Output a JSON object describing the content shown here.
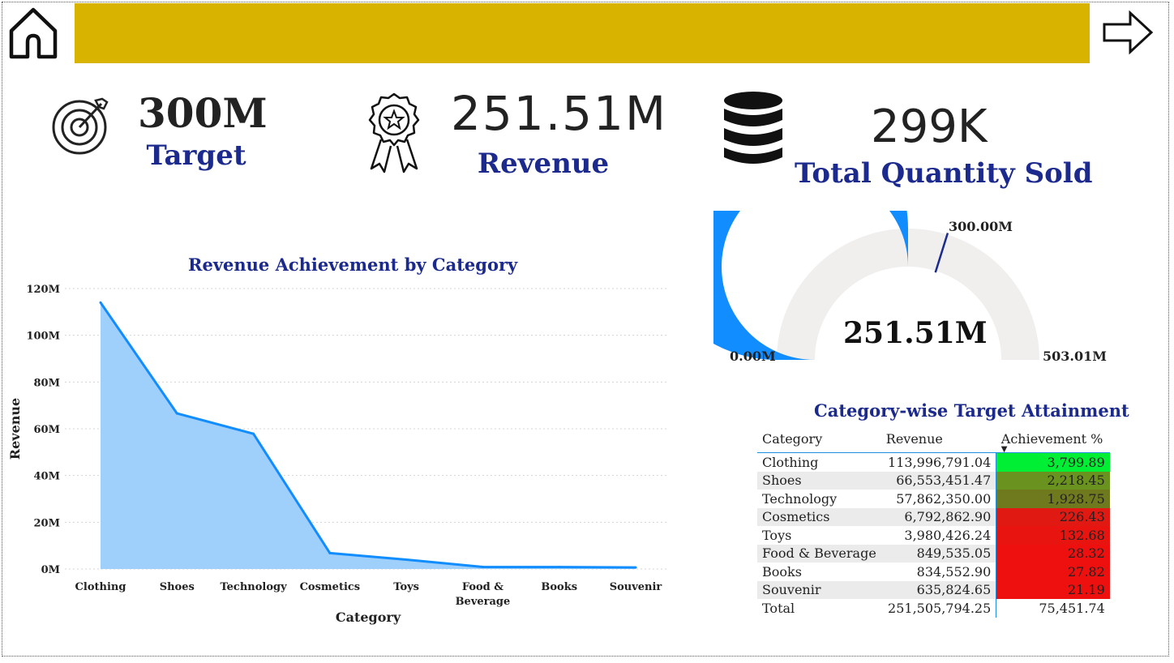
{
  "header": {
    "home_icon": "home-icon",
    "next_icon": "arrow-right-icon",
    "banner_color": "#d8b400"
  },
  "kpis": {
    "target": {
      "value": "300M",
      "label": "Target",
      "icon": "target-icon"
    },
    "revenue": {
      "value": "251.51M",
      "label": "Revenue",
      "icon": "award-ribbon-icon"
    },
    "quantity": {
      "value": "299K",
      "label": "Total Quantity Sold",
      "icon": "database-icon"
    }
  },
  "gauge": {
    "value": 251.51,
    "min": 0,
    "max": 503.01,
    "target": 300,
    "value_label": "251.51M",
    "min_label": "0.00M",
    "max_label": "503.01M",
    "target_label": "300.00M",
    "fill_color": "#118dff",
    "track_color": "#f0efee"
  },
  "chart_data": {
    "type": "area",
    "title": "Revenue Achievement by Category",
    "xlabel": "Category",
    "ylabel": "Revenue",
    "categories": [
      "Clothing",
      "Shoes",
      "Technology",
      "Cosmetics",
      "Toys",
      "Food & Beverage",
      "Books",
      "Souvenir"
    ],
    "values": [
      113996791.04,
      66553451.47,
      57862350.0,
      6792862.9,
      3980426.24,
      849535.05,
      834552.9,
      635824.65
    ],
    "yticks": [
      "0M",
      "20M",
      "40M",
      "60M",
      "80M",
      "100M",
      "120M"
    ],
    "ylim": [
      0,
      120000000
    ],
    "grid": true,
    "line_color": "#118dff",
    "fill_color": "#9fd0fb"
  },
  "table": {
    "title": "Category-wise Target Attainment",
    "columns": [
      "Category",
      "Revenue",
      "Achievement %"
    ],
    "rows": [
      {
        "category": "Clothing",
        "revenue": "113,996,791.04",
        "achievement": "3,799.89",
        "color": "#00ee33"
      },
      {
        "category": "Shoes",
        "revenue": "66,553,451.47",
        "achievement": "2,218.45",
        "color": "#6a921e"
      },
      {
        "category": "Technology",
        "revenue": "57,862,350.00",
        "achievement": "1,928.75",
        "color": "#6f7a1e"
      },
      {
        "category": "Cosmetics",
        "revenue": "6,792,862.90",
        "achievement": "226.43",
        "color": "#e01a12"
      },
      {
        "category": "Toys",
        "revenue": "3,980,426.24",
        "achievement": "132.68",
        "color": "#e8140f"
      },
      {
        "category": "Food & Beverage",
        "revenue": "849,535.05",
        "achievement": "28.32",
        "color": "#ee0f0f"
      },
      {
        "category": "Books",
        "revenue": "834,552.90",
        "achievement": "27.82",
        "color": "#ee0f0f"
      },
      {
        "category": "Souvenir",
        "revenue": "635,824.65",
        "achievement": "21.19",
        "color": "#ee0f0f"
      }
    ],
    "total": {
      "category": "Total",
      "revenue": "251,505,794.25",
      "achievement": "75,451.74"
    }
  }
}
